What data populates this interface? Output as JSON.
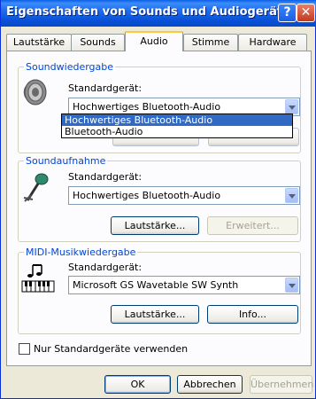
{
  "window": {
    "title": "Eigenschaften von Sounds und Audiogeräte",
    "help_symbol": "?",
    "close_symbol": "✕"
  },
  "tabs": [
    {
      "label": "Lautstärke",
      "active": false
    },
    {
      "label": "Sounds",
      "active": false
    },
    {
      "label": "Audio",
      "active": true
    },
    {
      "label": "Stimme",
      "active": false
    },
    {
      "label": "Hardware",
      "active": false
    }
  ],
  "playback": {
    "group_title": "Soundwiedergabe",
    "device_label": "Standardgerät:",
    "selected_device": "Hochwertiges Bluetooth-Audio",
    "dropdown_options": [
      "Hochwertiges Bluetooth-Audio",
      "Bluetooth-Audio"
    ],
    "icon": "speaker-icon"
  },
  "recording": {
    "group_title": "Soundaufnahme",
    "device_label": "Standardgerät:",
    "selected_device": "Hochwertiges Bluetooth-Audio",
    "volume_button": "Lautstärke...",
    "advanced_button": "Erweitert...",
    "icon": "microphone-icon"
  },
  "midi": {
    "group_title": "MIDI-Musikwiedergabe",
    "device_label": "Standardgerät:",
    "selected_device": "Microsoft GS Wavetable SW Synth",
    "volume_button": "Lautstärke...",
    "info_button": "Info...",
    "icon": "midi-keyboard-icon"
  },
  "use_default_only": {
    "label": "Nur Standardgeräte verwenden",
    "checked": false
  },
  "buttons": {
    "ok": "OK",
    "cancel": "Abbrechen",
    "apply": "Übernehmen"
  },
  "colors": {
    "titlebar": "#0a52d8",
    "group_title": "#0046d5",
    "selection": "#316ac5",
    "active_tab_accent": "#ffc83c"
  }
}
